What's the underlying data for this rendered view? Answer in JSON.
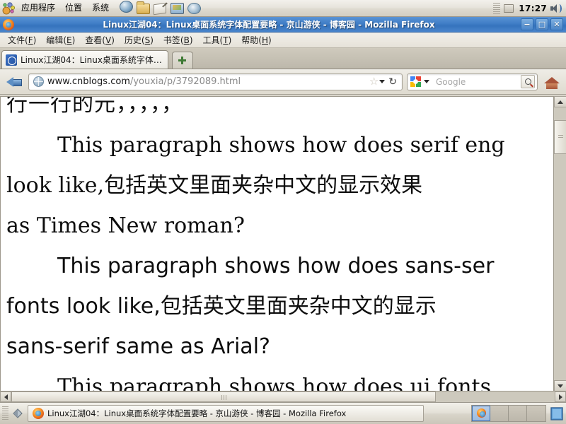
{
  "desktop": {
    "panel": {
      "menus": [
        {
          "label": "应用程序",
          "name": "applications-menu"
        },
        {
          "label": "位置",
          "name": "places-menu"
        },
        {
          "label": "系统",
          "name": "system-menu"
        }
      ],
      "launchers": [
        {
          "name": "web-browser-launcher-icon"
        },
        {
          "name": "file-manager-launcher-icon"
        },
        {
          "name": "text-editor-launcher-icon"
        },
        {
          "name": "presentation-launcher-icon"
        },
        {
          "name": "disc-launcher-icon"
        }
      ],
      "clock": "17:27",
      "tray": [
        {
          "name": "notification-area-icon"
        },
        {
          "name": "volume-speaker-icon"
        }
      ]
    },
    "taskbar": {
      "window_button": {
        "label": "Linux江湖04：Linux桌面系统字体配置要略 - 京山游侠 - 博客园 - Mozilla Firefox",
        "icon": "firefox-icon"
      },
      "workspaces": [
        {
          "name": "workspace-1",
          "active": true
        },
        {
          "name": "workspace-2",
          "active": false
        },
        {
          "name": "workspace-3",
          "active": false
        },
        {
          "name": "workspace-4",
          "active": false
        }
      ],
      "trash": {
        "name": "trash-icon"
      }
    }
  },
  "window": {
    "title": "Linux江湖04：Linux桌面系统字体配置要略 - 京山游侠 - 博客园 - Mozilla Firefox",
    "controls": {
      "minimize": "−",
      "maximize": "□",
      "close": "✕"
    }
  },
  "menubar": [
    {
      "label": "文件",
      "accel": "F"
    },
    {
      "label": "编辑",
      "accel": "E"
    },
    {
      "label": "查看",
      "accel": "V"
    },
    {
      "label": "历史",
      "accel": "S"
    },
    {
      "label": "书签",
      "accel": "B"
    },
    {
      "label": "工具",
      "accel": "T"
    },
    {
      "label": "帮助",
      "accel": "H"
    }
  ],
  "tabs": {
    "items": [
      {
        "label": "Linux江湖04：Linux桌面系统字体…"
      }
    ],
    "new_tab_label": "+"
  },
  "toolbar": {
    "back_label": "←",
    "url_scheme_host": "www.cnblogs.com",
    "url_path": "/youxia/p/3792089.html",
    "url_full": "www.cnblogs.com/youxia/p/3792089.html",
    "bookmark_star": "☆",
    "reload_label": "↻",
    "search_engine": "Google",
    "search_placeholder": "Google",
    "home_label": "Home"
  },
  "page_content": {
    "clipped_top_line": "行一行的元，，，，，",
    "paragraphs": [
      {
        "id": "serif-paragraph",
        "style": "serif",
        "lines": [
          "This paragraph shows how does serif eng",
          "look like,包括英文里面夹杂中文的显示效果",
          "as Times New roman?"
        ]
      },
      {
        "id": "sans-serif-paragraph",
        "style": "sans-serif",
        "lines": [
          "This paragraph shows how does sans-ser",
          "fonts look like,包括英文里面夹杂中文的显示",
          "sans-serif same as Arial?"
        ]
      },
      {
        "id": "ui-paragraph",
        "style": "ui",
        "lines": [
          "This paragraph shows how does ui fonts"
        ]
      }
    ]
  },
  "scrollbars": {
    "vertical": {
      "up": "▲",
      "down": "▼"
    },
    "horizontal": {
      "left": "◀",
      "right": "▶"
    }
  },
  "colors": {
    "titlebar_blue": "#4280c8",
    "panel_grey": "#e7e4dc",
    "page_white": "#ffffff",
    "accent_firefox": "#f79022"
  }
}
